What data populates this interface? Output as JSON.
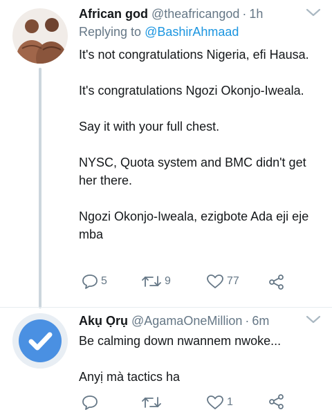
{
  "tweets": [
    {
      "name": "African god",
      "handle": "@theafricangod",
      "separator": "·",
      "time": "1h",
      "replying_prefix": "Replying to",
      "replying_to": "@BashirAhmaad",
      "paragraphs": [
        "It's not congratulations Nigeria, efi Hausa.",
        "It's congratulations Ngozi Okonjo-Iweala.",
        "Say it with your full chest.",
        "NYSC, Quota system and BMC didn't get her there.",
        "Ngozi Okonjo-Iweala, ezigbote Ada eji eje mba"
      ],
      "replies": "5",
      "retweets": "9",
      "likes": "77",
      "avatar_icon": "profile-photo"
    },
    {
      "name": "Akụ Ọrụ",
      "handle": "@AgamaOneMillion",
      "separator": "·",
      "time": "6m",
      "paragraphs": [
        "Be calming down nwannem nwoke...",
        "Anyị mà tactics ha"
      ],
      "replies": "",
      "retweets": "",
      "likes": "1",
      "avatar_icon": "checkmark-icon"
    }
  ],
  "colors": {
    "link": "#1b95e0",
    "muted": "#657786",
    "thread_line": "#ccd6dd",
    "avatar_blue": "#4a90e2"
  }
}
